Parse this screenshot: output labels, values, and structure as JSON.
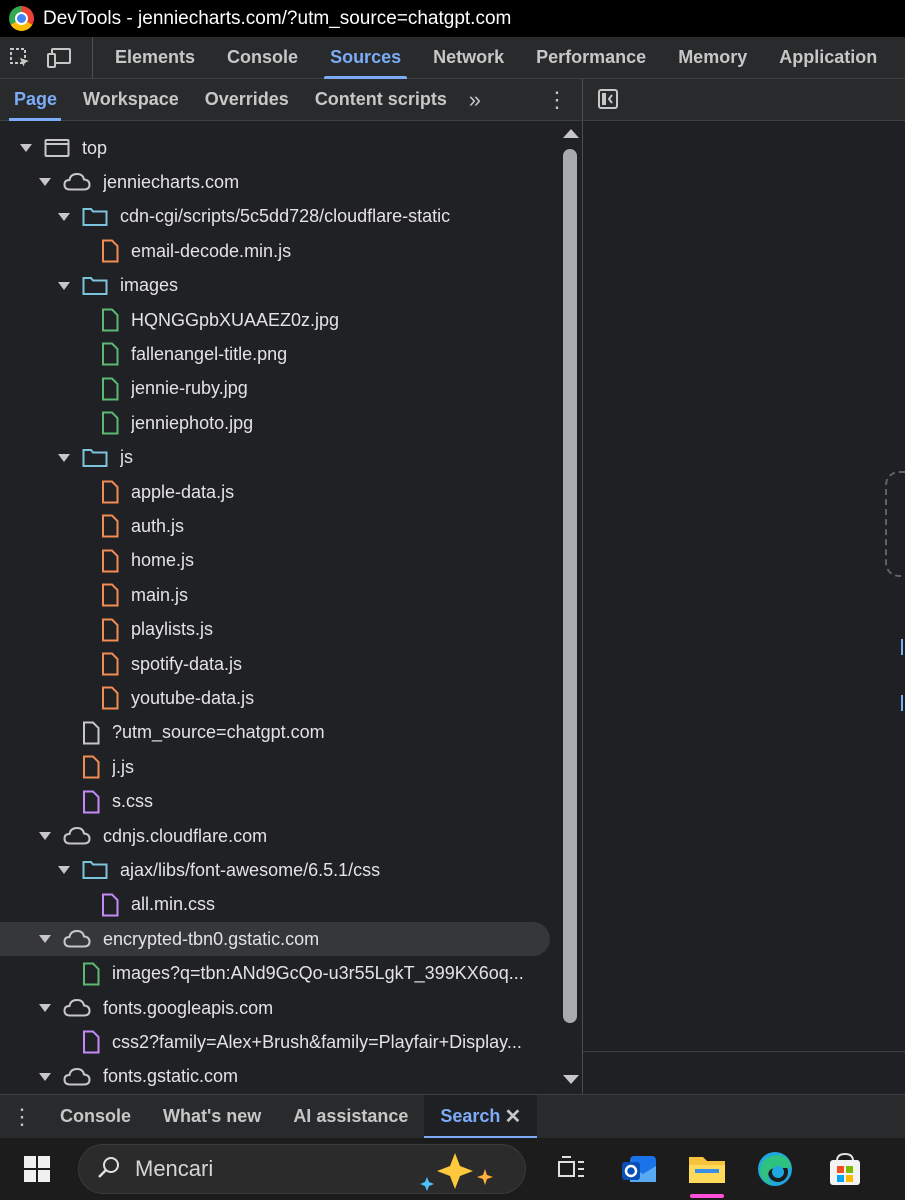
{
  "window": {
    "title": "DevTools - jenniecharts.com/?utm_source=chatgpt.com"
  },
  "main_tabs": [
    {
      "label": "Elements",
      "active": false
    },
    {
      "label": "Console",
      "active": false
    },
    {
      "label": "Sources",
      "active": true
    },
    {
      "label": "Network",
      "active": false
    },
    {
      "label": "Performance",
      "active": false
    },
    {
      "label": "Memory",
      "active": false
    },
    {
      "label": "Application",
      "active": false
    }
  ],
  "sub_tabs": [
    {
      "label": "Page",
      "active": true
    },
    {
      "label": "Workspace",
      "active": false
    },
    {
      "label": "Overrides",
      "active": false
    },
    {
      "label": "Content scripts",
      "active": false
    }
  ],
  "tree": [
    {
      "label": "top",
      "type": "frame",
      "depth": 0,
      "expanded": true
    },
    {
      "label": "jenniecharts.com",
      "type": "cloud",
      "depth": 1,
      "expanded": true
    },
    {
      "label": "cdn-cgi/scripts/5c5dd728/cloudflare-static",
      "type": "folder",
      "depth": 2,
      "expanded": true
    },
    {
      "label": "email-decode.min.js",
      "type": "js",
      "depth": 3
    },
    {
      "label": "images",
      "type": "folder",
      "depth": 2,
      "expanded": true
    },
    {
      "label": "HQNGGpbXUAAEZ0z.jpg",
      "type": "img",
      "depth": 3
    },
    {
      "label": "fallenangel-title.png",
      "type": "img",
      "depth": 3
    },
    {
      "label": "jennie-ruby.jpg",
      "type": "img",
      "depth": 3
    },
    {
      "label": "jenniephoto.jpg",
      "type": "img",
      "depth": 3
    },
    {
      "label": "js",
      "type": "folder",
      "depth": 2,
      "expanded": true
    },
    {
      "label": "apple-data.js",
      "type": "js",
      "depth": 3
    },
    {
      "label": "auth.js",
      "type": "js",
      "depth": 3
    },
    {
      "label": "home.js",
      "type": "js",
      "depth": 3
    },
    {
      "label": "main.js",
      "type": "js",
      "depth": 3
    },
    {
      "label": "playlists.js",
      "type": "js",
      "depth": 3
    },
    {
      "label": "spotify-data.js",
      "type": "js",
      "depth": 3
    },
    {
      "label": "youtube-data.js",
      "type": "js",
      "depth": 3
    },
    {
      "label": "?utm_source=chatgpt.com",
      "type": "doc",
      "depth": 2
    },
    {
      "label": "j.js",
      "type": "js",
      "depth": 2
    },
    {
      "label": "s.css",
      "type": "css",
      "depth": 2
    },
    {
      "label": "cdnjs.cloudflare.com",
      "type": "cloud",
      "depth": 1,
      "expanded": true
    },
    {
      "label": "ajax/libs/font-awesome/6.5.1/css",
      "type": "folder",
      "depth": 2,
      "expanded": true
    },
    {
      "label": "all.min.css",
      "type": "css",
      "depth": 3
    },
    {
      "label": "encrypted-tbn0.gstatic.com",
      "type": "cloud",
      "depth": 1,
      "expanded": true,
      "hover": true
    },
    {
      "label": "images?q=tbn:ANd9GcQo-u3r55LgkT_399KX6oq...",
      "type": "img",
      "depth": 2
    },
    {
      "label": "fonts.googleapis.com",
      "type": "cloud",
      "depth": 1,
      "expanded": true
    },
    {
      "label": "css2?family=Alex+Brush&family=Playfair+Display...",
      "type": "css",
      "depth": 2
    },
    {
      "label": "fonts.gstatic.com",
      "type": "cloud",
      "depth": 1,
      "expanded": true
    }
  ],
  "drawer_tabs": [
    {
      "label": "Console",
      "active": false
    },
    {
      "label": "What's new",
      "active": false
    },
    {
      "label": "AI assistance",
      "active": false
    },
    {
      "label": "Search",
      "active": true,
      "closable": true
    }
  ],
  "taskbar": {
    "search_placeholder": "Mencari",
    "apps": [
      "task-view",
      "outlook",
      "file-explorer",
      "edge",
      "microsoft-store"
    ]
  },
  "colors": {
    "accent": "#7cacf8",
    "js_icon": "#f28b54",
    "img_icon": "#5bb974",
    "css_icon": "#c58af9",
    "folder_icon": "#7cc4dd"
  }
}
